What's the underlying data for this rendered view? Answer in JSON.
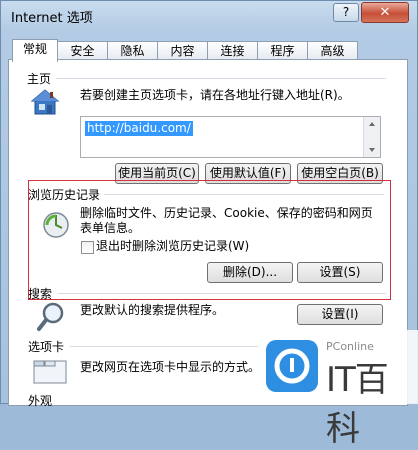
{
  "window": {
    "title": "Internet 选项",
    "help_label": "?",
    "close_label": "✕"
  },
  "tabs": [
    {
      "label": "常规",
      "active": true
    },
    {
      "label": "安全",
      "active": false
    },
    {
      "label": "隐私",
      "active": false
    },
    {
      "label": "内容",
      "active": false
    },
    {
      "label": "连接",
      "active": false
    },
    {
      "label": "程序",
      "active": false
    },
    {
      "label": "高级",
      "active": false
    }
  ],
  "home": {
    "title": "主页",
    "description": "若要创建主页选项卡，请在各地址行键入地址(R)。",
    "url": "http://baidu.com/",
    "buttons": {
      "use_current": "使用当前页(C)",
      "use_default": "使用默认值(F)",
      "use_blank": "使用空白页(B)"
    }
  },
  "history": {
    "title": "浏览历史记录",
    "description_line1": "删除临时文件、历史记录、Cookie、保存的密码和网页",
    "description_line2": "表单信息。",
    "checkbox_label": "退出时删除浏览历史记录(W)",
    "checkbox_checked": false,
    "delete_button": "删除(D)...",
    "settings_button": "设置(S)"
  },
  "search": {
    "title": "搜索",
    "description": "更改默认的搜索提供程序。",
    "settings_button": "设置(I)"
  },
  "tab_settings": {
    "title": "选项卡",
    "description": "更改网页在选项卡中显示的方式。"
  },
  "appearance": {
    "title": "外观"
  },
  "watermark": {
    "small": "PConline",
    "big": "IT百科"
  },
  "colors": {
    "selection": "#3399ff",
    "highlight_box": "#d6303a",
    "watermark_blue": "#2e8fe2"
  }
}
